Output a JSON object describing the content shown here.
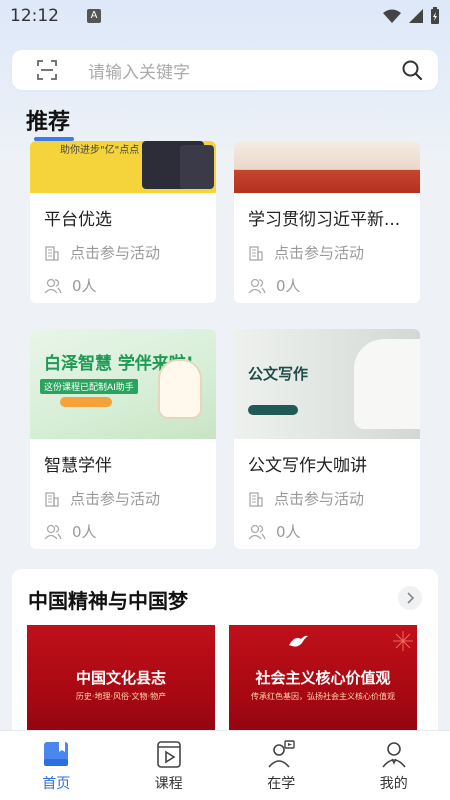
{
  "status_bar": {
    "time": "12:12",
    "a_badge": "A"
  },
  "search": {
    "placeholder": "请输入关键字"
  },
  "recommend": {
    "title": "推荐",
    "cards": [
      {
        "title": "平台优选",
        "thumb_text": "助你进步\"亿\"点点",
        "meta_activity": "点击参与活动",
        "meta_people": "0人"
      },
      {
        "title": "学习贯彻习近平新...",
        "meta_activity": "点击参与活动",
        "meta_people": "0人"
      },
      {
        "title": "智慧学伴",
        "thumb_heading": "白泽智慧 学伴来啦!",
        "thumb_sub": "这份课程已配制AI助手",
        "meta_activity": "点击参与活动",
        "meta_people": "0人"
      },
      {
        "title": "公文写作大咖讲",
        "thumb_heading": "公文写作",
        "meta_activity": "点击参与活动",
        "meta_people": "0人"
      }
    ]
  },
  "dream": {
    "title": "中国精神与中国梦",
    "banners": [
      {
        "title": "中国文化县志",
        "subtitle": "历史·地理·风俗·文物·物产"
      },
      {
        "title": "社会主义核心价值观",
        "subtitle": "传承红色基因，弘扬社会主义核心价值观"
      }
    ]
  },
  "nav": [
    {
      "label": "首页",
      "icon": "home-book-icon",
      "active": true
    },
    {
      "label": "课程",
      "icon": "course-video-icon",
      "active": false
    },
    {
      "label": "在学",
      "icon": "learning-person-icon",
      "active": false
    },
    {
      "label": "我的",
      "icon": "profile-icon",
      "active": false
    }
  ],
  "colors": {
    "accent": "#2d6fe0",
    "banner_red": "#b5101a",
    "yellow": "#f4d43a"
  }
}
